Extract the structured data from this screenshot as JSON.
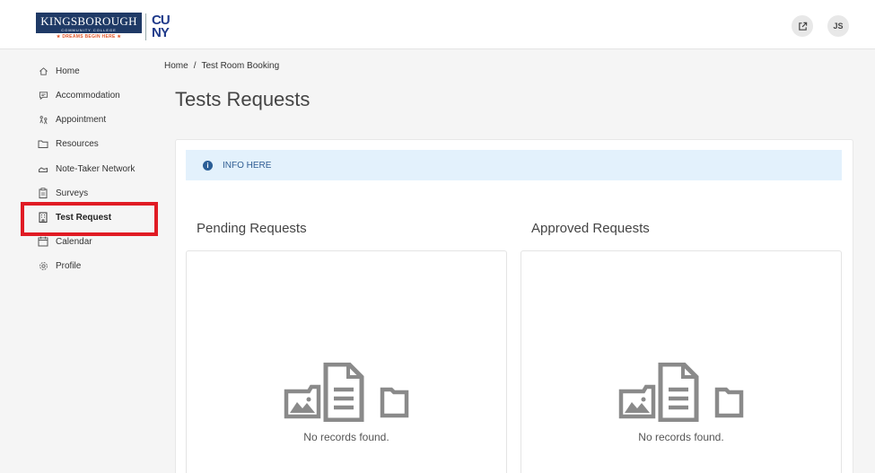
{
  "brand": {
    "college_name": "KINGSBOROUGH",
    "college_sub": "COMMUNITY COLLEGE",
    "tagline": "★ DREAMS BEGIN HERE ★",
    "cuny_line1": "CU",
    "cuny_line2": "NY"
  },
  "header": {
    "external_icon": "external-link-icon",
    "avatar_initials": "JS"
  },
  "sidebar": {
    "items": [
      {
        "label": "Home",
        "icon": "home-icon"
      },
      {
        "label": "Accommodation",
        "icon": "chat-icon"
      },
      {
        "label": "Appointment",
        "icon": "people-icon"
      },
      {
        "label": "Resources",
        "icon": "folder-icon"
      },
      {
        "label": "Note-Taker Network",
        "icon": "hand-icon"
      },
      {
        "label": "Surveys",
        "icon": "clipboard-icon"
      },
      {
        "label": "Test Request",
        "icon": "building-icon",
        "active": true
      },
      {
        "label": "Calendar",
        "icon": "calendar-icon"
      },
      {
        "label": "Profile",
        "icon": "gear-icon"
      }
    ]
  },
  "breadcrumb": {
    "home": "Home",
    "separator": "/",
    "current": "Test Room Booking"
  },
  "page": {
    "title": "Tests Requests",
    "info_text": "INFO HERE"
  },
  "sections": {
    "pending": {
      "title": "Pending Requests",
      "empty_text": "No records found."
    },
    "approved": {
      "title": "Approved Requests",
      "empty_text": "No records found."
    }
  },
  "colors": {
    "brand_navy": "#1f3a66",
    "highlight_red": "#e01b24",
    "info_bg": "#e3f1fc",
    "info_text": "#2f5d92"
  }
}
